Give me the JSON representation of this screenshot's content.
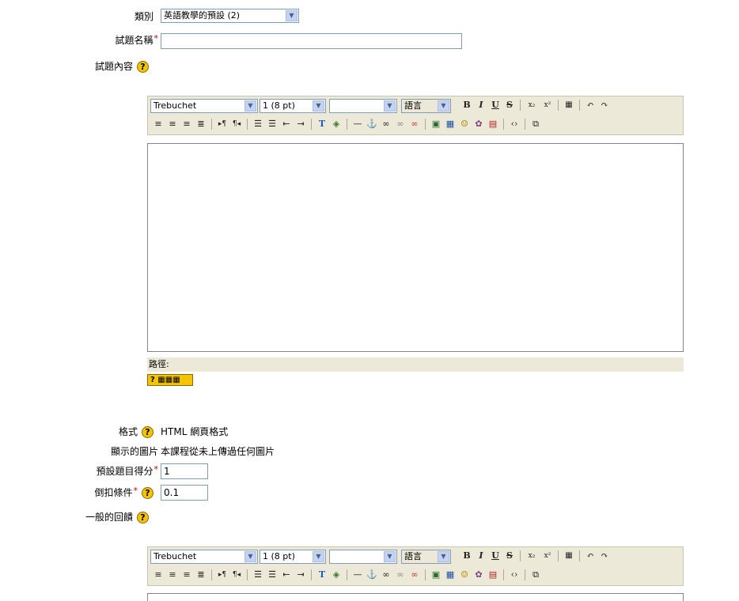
{
  "form": {
    "category": {
      "label": "類別",
      "value": "英語教學的預設 (2)"
    },
    "question_name": {
      "label": "試題名稱",
      "value": ""
    },
    "question_text": {
      "label": "試題內容"
    },
    "format": {
      "label": "格式",
      "value": "HTML 網頁格式"
    },
    "image_display": {
      "label": "顯示的圖片",
      "value": "本課程從未上傳過任何圖片"
    },
    "default_grade": {
      "label": "預設題目得分",
      "value": "1"
    },
    "penalty": {
      "label": "倒扣條件",
      "value": "0.1"
    },
    "general_feedback": {
      "label": "一般的回饋"
    },
    "required_mark": "*",
    "help_mark": "?"
  },
  "editor": {
    "font": "Trebuchet",
    "size": "1 (8 pt)",
    "style": "",
    "language": "語言",
    "path_label": "路徑:",
    "keyboard_help": "?"
  },
  "colors": {
    "toolbar_bg": "#ece9d8",
    "help_icon": "#f5c400",
    "required": "#cc0000"
  }
}
